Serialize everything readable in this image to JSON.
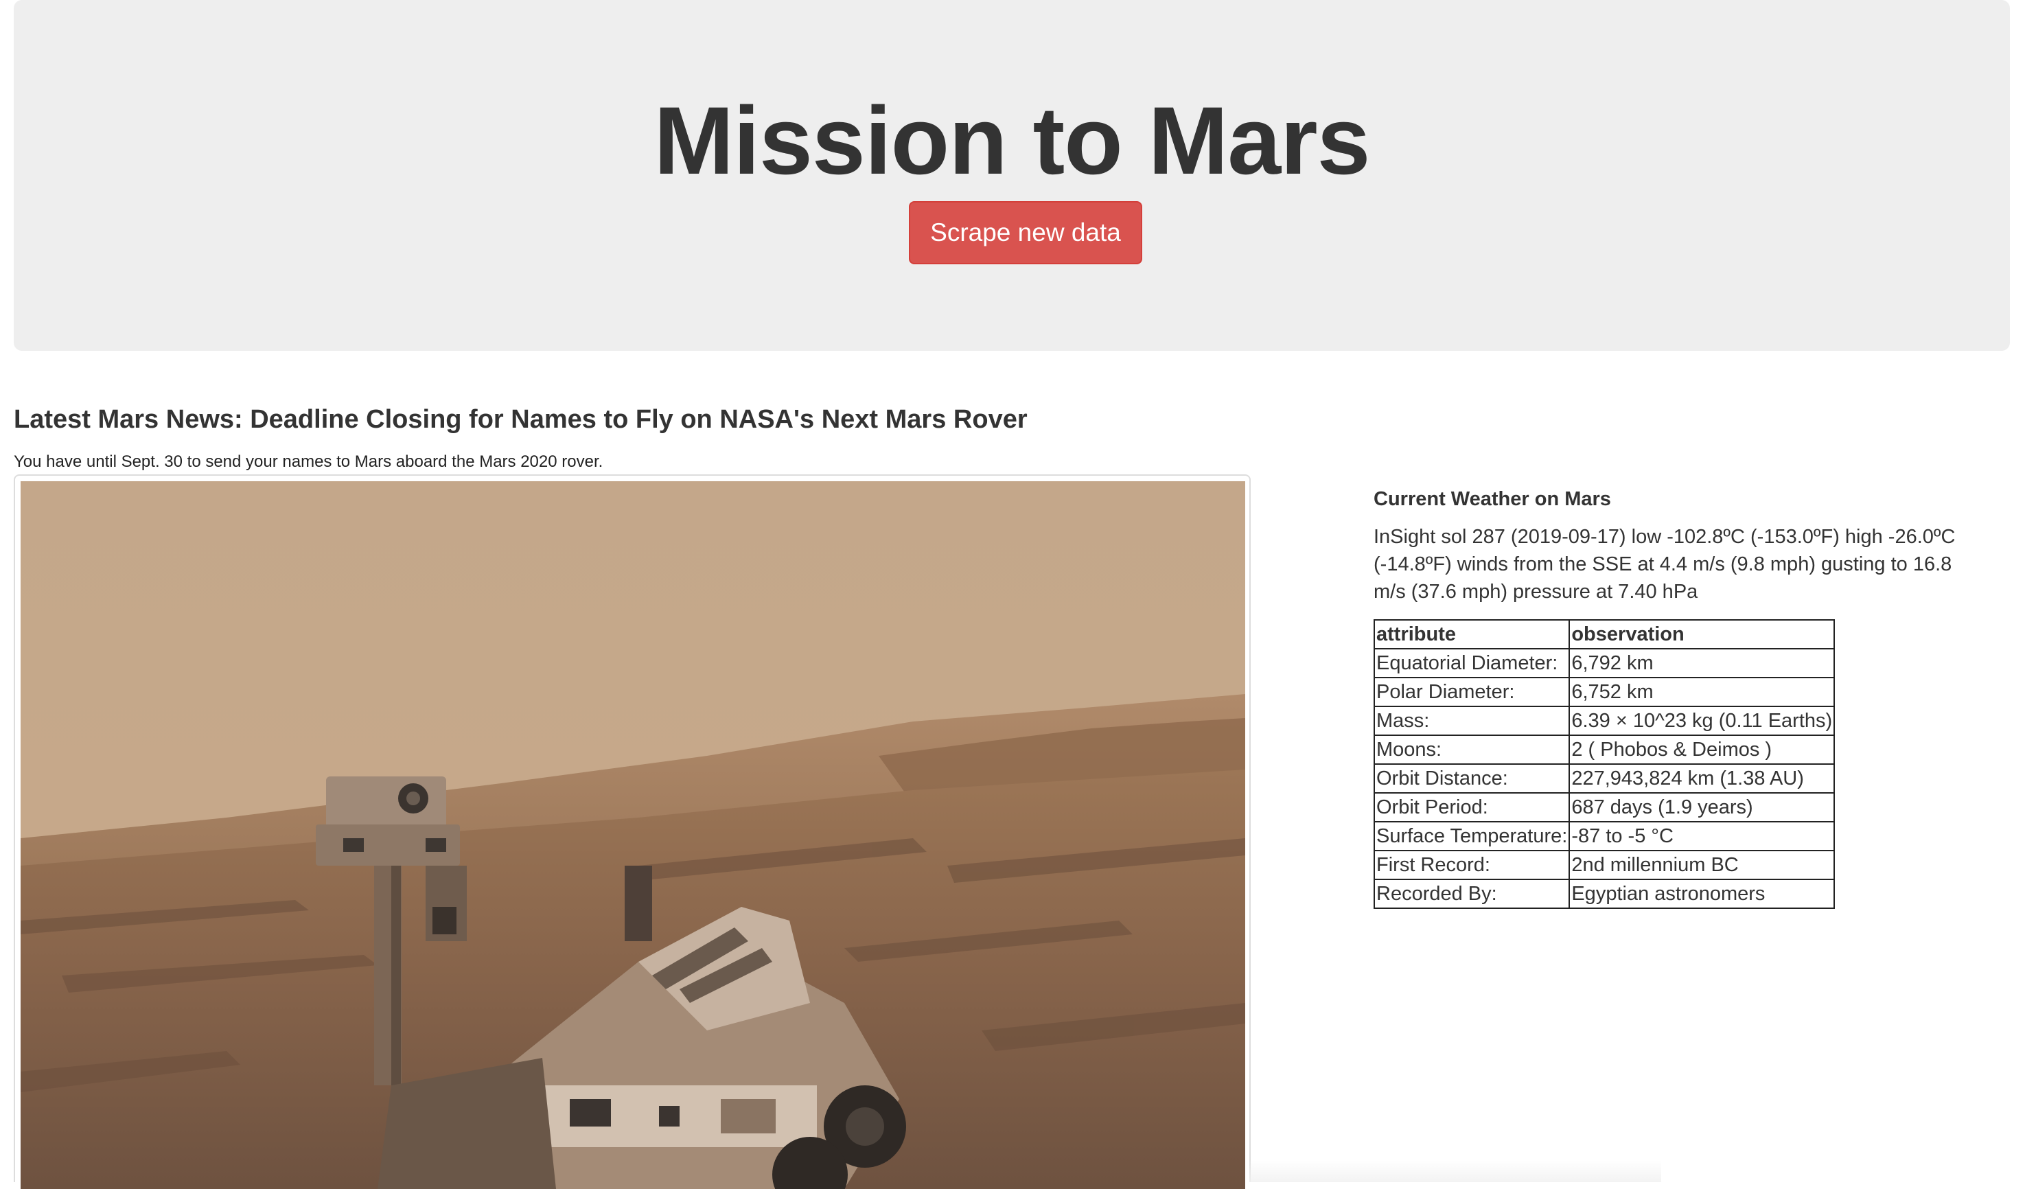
{
  "header": {
    "title": "Mission to Mars",
    "scrape_button_label": "Scrape new data"
  },
  "news": {
    "title": "Latest Mars News: Deadline Closing for Names to Fly on NASA's Next Mars Rover",
    "teaser": "You have until Sept. 30 to send your names to Mars aboard the Mars 2020 rover."
  },
  "featured_image": {
    "alt": "Mars rover selfie on the Martian surface",
    "colors": {
      "sky": "#c5a889",
      "horizon": "#b89472",
      "ground": "#8e6a4c",
      "rover": "#a88a70"
    }
  },
  "weather": {
    "heading": "Current Weather on Mars",
    "text": "InSight sol 287 (2019-09-17) low -102.8ºC (-153.0ºF) high -26.0ºC (-14.8ºF) winds from the SSE at 4.4 m/s (9.8 mph) gusting to 16.8 m/s (37.6 mph) pressure at 7.40 hPa"
  },
  "facts": {
    "headers": [
      "attribute",
      "observation"
    ],
    "rows": [
      [
        "Equatorial Diameter:",
        "6,792 km"
      ],
      [
        "Polar Diameter:",
        "6,752 km"
      ],
      [
        "Mass:",
        "6.39 × 10^23 kg (0.11 Earths)"
      ],
      [
        "Moons:",
        "2 ( Phobos & Deimos )"
      ],
      [
        "Orbit Distance:",
        "227,943,824 km (1.38 AU)"
      ],
      [
        "Orbit Period:",
        "687 days (1.9 years)"
      ],
      [
        "Surface Temperature:",
        "-87 to -5 °C"
      ],
      [
        "First Record:",
        "2nd millennium BC"
      ],
      [
        "Recorded By:",
        "Egyptian astronomers"
      ]
    ]
  },
  "theme": {
    "jumbotron_bg": "#eeeeee",
    "danger_button": "#d9534f",
    "text": "#333333"
  }
}
